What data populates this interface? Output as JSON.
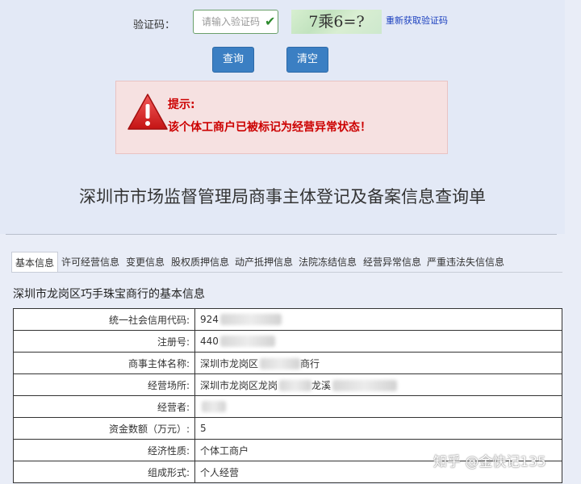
{
  "captcha": {
    "label": "验证码：",
    "placeholder": "请输入验证码",
    "image_text": "7乘6=?",
    "refresh_link": "重新获取验证码"
  },
  "buttons": {
    "query": "查询",
    "clear": "清空"
  },
  "alert": {
    "title": "提示:",
    "message": "该个体工商户已被标记为经营异常状态！"
  },
  "page_title": "深圳市市场监督管理局商事主体登记及备案信息查询单",
  "tabs": [
    {
      "label": "基本信息"
    },
    {
      "label": "许可经营信息"
    },
    {
      "label": "变更信息"
    },
    {
      "label": "股权质押信息"
    },
    {
      "label": "动产抵押信息"
    },
    {
      "label": "法院冻结信息"
    },
    {
      "label": "经营异常信息"
    },
    {
      "label": "严重违法失信信息"
    }
  ],
  "section_title": "深圳市龙岗区巧手珠宝商行的基本信息",
  "rows": [
    {
      "key": "统一社会信用代码:",
      "value": "924"
    },
    {
      "key": "注册号:",
      "value": "440"
    },
    {
      "key": "商事主体名称:",
      "value": "深圳市龙岗区",
      "suffix": "商行"
    },
    {
      "key": "经营场所:",
      "value": "深圳市龙岗区龙岗",
      "suffix": "龙溪"
    },
    {
      "key": "经营者:",
      "value": ""
    },
    {
      "key": "资金数额（万元）:",
      "value": "5"
    },
    {
      "key": "经济性质:",
      "value": "个体工商户"
    },
    {
      "key": "组成形式:",
      "value": "个人经营"
    }
  ],
  "watermark": "知乎 @金快记135",
  "colors": {
    "accent_button": "#3b7fc3",
    "alert_text": "#cc0000",
    "alert_bg": "#f6e1e1"
  }
}
